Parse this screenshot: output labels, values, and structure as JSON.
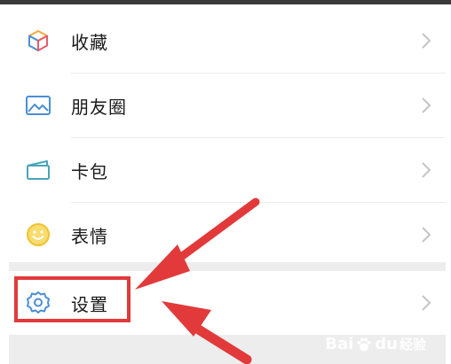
{
  "menu": {
    "items": [
      {
        "label": "收藏",
        "icon": "cube-icon"
      },
      {
        "label": "朋友圈",
        "icon": "image-icon"
      },
      {
        "label": "卡包",
        "icon": "wallet-icon"
      },
      {
        "label": "表情",
        "icon": "smiley-icon"
      },
      {
        "label": "设置",
        "icon": "gear-icon"
      }
    ]
  },
  "watermark": {
    "brand_a": "Bai",
    "brand_b": "du",
    "suffix": "经验"
  },
  "colors": {
    "highlight": "#e23a3a",
    "icon_blue": "#4a8fd6",
    "icon_yellow": "#f2c230"
  }
}
